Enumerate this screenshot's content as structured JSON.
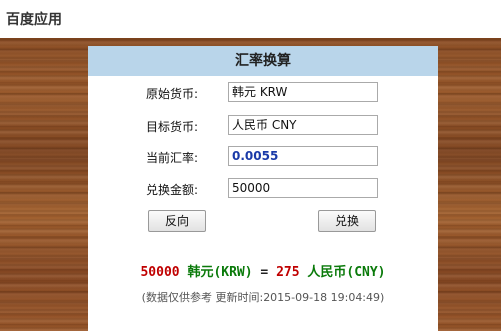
{
  "app": {
    "title": "百度应用"
  },
  "converter": {
    "title": "汇率换算",
    "source_label": "原始货币:",
    "source_value": "韩元 KRW",
    "target_label": "目标货币:",
    "target_value": "人民币 CNY",
    "rate_label": "当前汇率:",
    "rate_value": "0.0055",
    "amount_label": "兑换金额:",
    "amount_value": "50000",
    "reverse_button": "反向",
    "convert_button": "兑换"
  },
  "result": {
    "from_amount": "50000",
    "from_currency": "韩元(KRW)",
    "equals": "=",
    "to_amount": "275",
    "to_currency": "人民币(CNY)"
  },
  "note": {
    "disclaimer": "(数据仅供参考",
    "updated_label": "更新时间:",
    "updated_time": "2015-09-18 19:04:49)"
  },
  "colors": {
    "header_bar": "#b9d5ea",
    "amount_red": "#c00000",
    "currency_green": "#0a7a0a",
    "rate_blue": "#1a3aa8"
  }
}
